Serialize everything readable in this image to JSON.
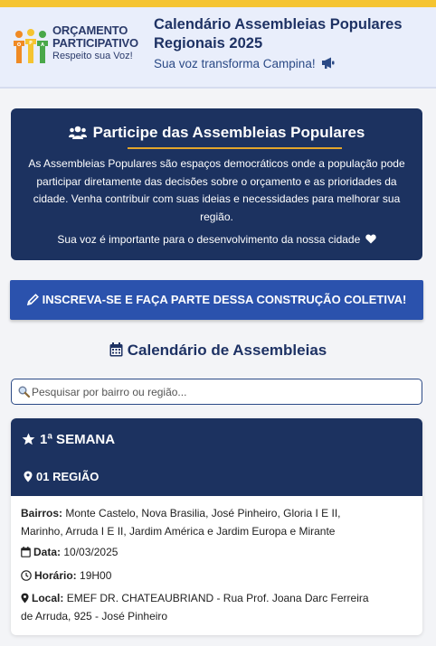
{
  "header": {
    "logo": {
      "line1": "ORÇAMENTO",
      "line2": "PARTICIPATIVO",
      "tagline": "Respeito sua Voz!",
      "figure_letters": [
        "O",
        "P",
        "A"
      ]
    },
    "title": "Calendário Assembleias Populares Regionais 2025",
    "subtitle": "Sua voz transforma Campina!",
    "subtitle_icon": "megaphone-icon"
  },
  "intro": {
    "heading": "Participe das Assembleias Populares",
    "heading_icon": "users-icon",
    "paragraph": "As Assembleias Populares são espaços democráticos onde a população pode participar diretamente das decisões sobre o orçamento e as prioridades da cidade. Venha contribuir com suas ideias e necessidades para melhorar sua região.",
    "paragraph2": "Sua voz é importante para o desenvolvimento da nossa cidade",
    "heart_icon": "heart-icon"
  },
  "cta": {
    "label": "INSCREVA-SE E FAÇA PARTE DESSA CONSTRUÇÃO COLETIVA!",
    "icon": "pencil-icon"
  },
  "calendar": {
    "title": "Calendário de Assembleias",
    "icon": "calendar-icon",
    "search_placeholder": "Pesquisar por bairro ou região..."
  },
  "card": {
    "week": "1ª SEMANA",
    "region": "01 REGIÃO",
    "bairros_label": "Bairros:",
    "bairros": "Monte Castelo, Nova Brasilia, José Pinheiro, Gloria I E II, Marinho, Arruda I E II, Jardim América e Jardim Europa e Mirante",
    "data_label": "Data:",
    "data": "10/03/2025",
    "horario_label": "Horário:",
    "horario": "19H00",
    "local_label": "Local:",
    "local": "EMEF DR. CHATEAUBRIAND - Rua Prof. Joana Darc Ferreira de Arruda, 925 - José Pinheiro"
  },
  "colors": {
    "navy": "#1c3260",
    "accent_yellow": "#f5c431",
    "cta_blue": "#2b52ad",
    "underline_orange": "#e3a52a"
  }
}
